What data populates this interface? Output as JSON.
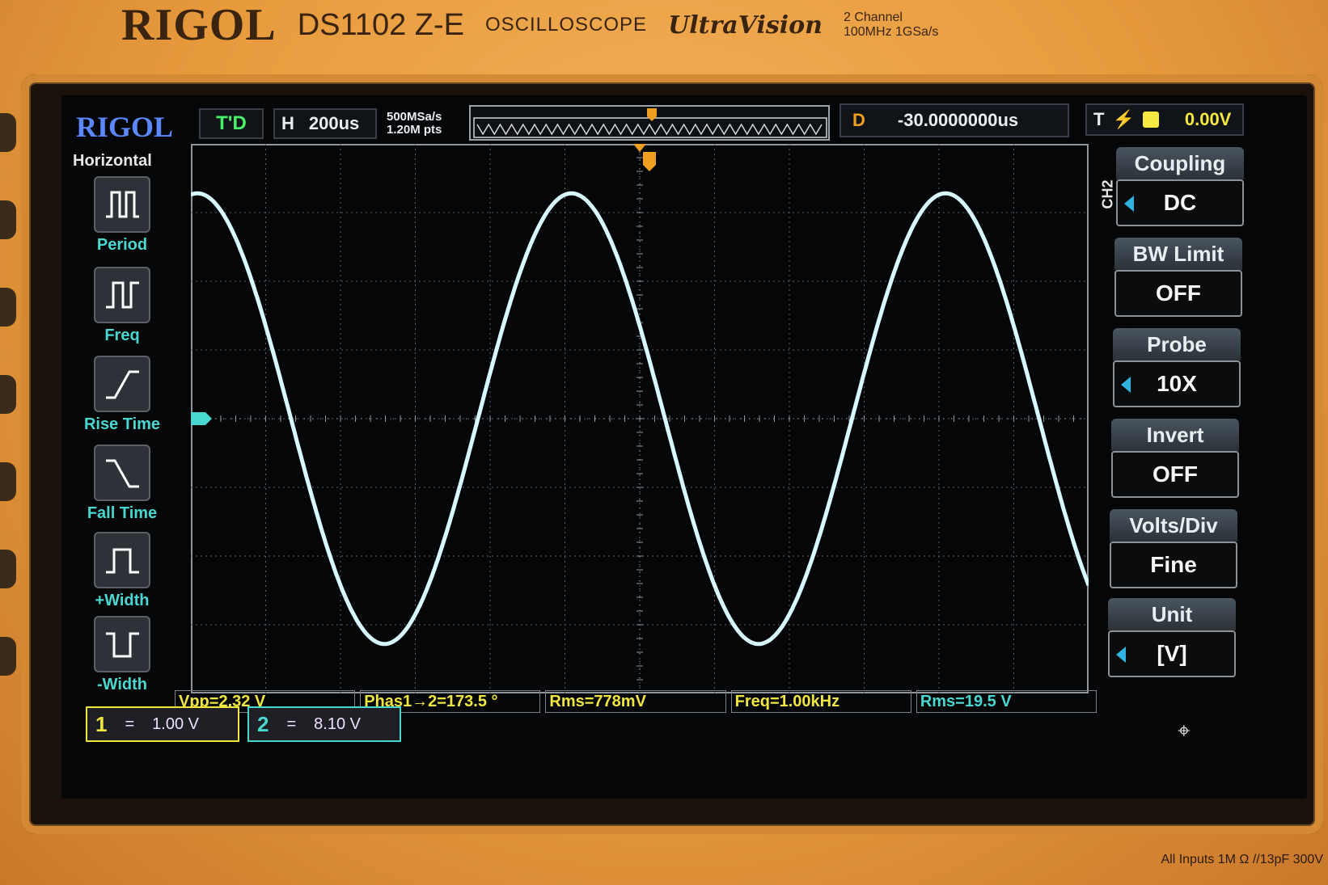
{
  "device": {
    "brand": "RIGOL",
    "model": "DS1102",
    "model_suffix": "Z-E",
    "type": "OSCILLOSCOPE",
    "series": "UltraVision",
    "spec_line1": "2 Channel",
    "spec_line2": "100MHz  1GSa/s",
    "inputs_note": "All Inputs 1M Ω //13pF 300V"
  },
  "screen": {
    "logo": "RIGOL",
    "trigger_status": "T'D",
    "timebase_label": "H",
    "timebase_value": "200us",
    "sample_rate": "500MSa/s",
    "memory_points": "1.20M pts",
    "delay_label": "D",
    "delay_value": "-30.0000000us",
    "trigger_label": "T",
    "trigger_level": "0.00V"
  },
  "measure_menu": {
    "title": "Horizontal",
    "items": [
      {
        "label": "Period",
        "icon": "period-icon"
      },
      {
        "label": "Freq",
        "icon": "frequency-icon"
      },
      {
        "label": "Rise Time",
        "icon": "rise-time-icon"
      },
      {
        "label": "Fall Time",
        "icon": "fall-time-icon"
      },
      {
        "label": "+Width",
        "icon": "positive-width-icon"
      },
      {
        "label": "-Width",
        "icon": "negative-width-icon"
      }
    ]
  },
  "channel_menu": {
    "channel": "CH2",
    "items": [
      {
        "label": "Coupling",
        "value": "DC",
        "selectable": true
      },
      {
        "label": "BW Limit",
        "value": "OFF",
        "selectable": false
      },
      {
        "label": "Probe",
        "value": "10X",
        "selectable": true
      },
      {
        "label": "Invert",
        "value": "OFF",
        "selectable": false
      },
      {
        "label": "Volts/Div",
        "value": "Fine",
        "selectable": false
      },
      {
        "label": "Unit",
        "value": "[V]",
        "selectable": true
      }
    ]
  },
  "measurements": [
    {
      "text": "Vpp=2.32 V"
    },
    {
      "text": "Phas1→2=173.5 °"
    },
    {
      "text": "Rms=778mV"
    },
    {
      "text": "Freq=1.00kHz"
    },
    {
      "text": "Rms=19.5 V"
    }
  ],
  "channels": [
    {
      "number": "1",
      "scale": "1.00 V"
    },
    {
      "number": "2",
      "scale": "8.10 V"
    }
  ],
  "colors": {
    "ch1": "#f0e640",
    "ch2": "#48d8d0",
    "trigger": "#f0a020",
    "trace": "#d8f8ff"
  },
  "waveform": {
    "channel": "2",
    "shape": "sine",
    "frequency_hz": 1000,
    "cycles_on_screen": 2.4
  }
}
